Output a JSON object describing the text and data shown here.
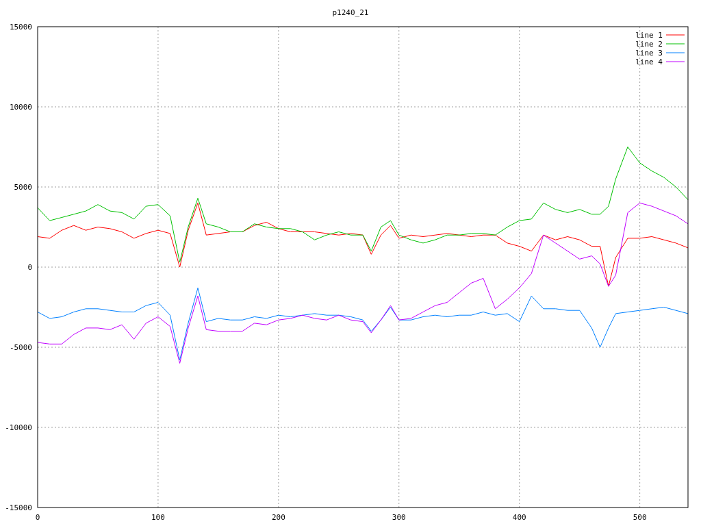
{
  "chart_data": {
    "type": "line",
    "title": "p1240_21",
    "x": [
      0,
      10,
      20,
      30,
      40,
      50,
      60,
      70,
      80,
      90,
      100,
      110,
      118,
      125,
      133,
      140,
      150,
      160,
      170,
      180,
      190,
      200,
      210,
      220,
      230,
      240,
      250,
      260,
      270,
      277,
      285,
      293,
      300,
      310,
      320,
      330,
      340,
      350,
      360,
      370,
      380,
      390,
      400,
      410,
      420,
      430,
      440,
      450,
      460,
      467,
      474,
      480,
      490,
      500,
      510,
      520,
      530,
      540
    ],
    "series": [
      {
        "name": "line 1",
        "color": "#ff0000",
        "values": [
          1900,
          1800,
          2300,
          2600,
          2300,
          2500,
          2400,
          2200,
          1800,
          2100,
          2300,
          2100,
          0,
          2300,
          4000,
          2000,
          2100,
          2200,
          2200,
          2600,
          2800,
          2400,
          2200,
          2200,
          2200,
          2100,
          2000,
          2100,
          2000,
          800,
          2000,
          2600,
          1800,
          2000,
          1900,
          2000,
          2100,
          2000,
          1900,
          2000,
          2000,
          1500,
          1300,
          1000,
          2000,
          1700,
          1900,
          1700,
          1300,
          1300,
          -1200,
          600,
          1800,
          1800,
          1900,
          1700,
          1500,
          1200
        ]
      },
      {
        "name": "line 2",
        "color": "#00c000",
        "values": [
          3700,
          2900,
          3100,
          3300,
          3500,
          3900,
          3500,
          3400,
          3000,
          3800,
          3900,
          3200,
          300,
          2500,
          4300,
          2700,
          2500,
          2200,
          2200,
          2700,
          2500,
          2400,
          2400,
          2200,
          1700,
          2000,
          2200,
          2000,
          2000,
          1000,
          2500,
          2900,
          2000,
          1700,
          1500,
          1700,
          2000,
          2000,
          2100,
          2100,
          2000,
          2500,
          2900,
          3000,
          4000,
          3600,
          3400,
          3600,
          3300,
          3300,
          3800,
          5500,
          7500,
          6500,
          6000,
          5600,
          5000,
          4200
        ]
      },
      {
        "name": "line 3",
        "color": "#0080ff",
        "values": [
          -2800,
          -3200,
          -3100,
          -2800,
          -2600,
          -2600,
          -2700,
          -2800,
          -2800,
          -2400,
          -2200,
          -3000,
          -5800,
          -3500,
          -1300,
          -3400,
          -3200,
          -3300,
          -3300,
          -3100,
          -3200,
          -3000,
          -3100,
          -3000,
          -2900,
          -3000,
          -3000,
          -3100,
          -3300,
          -4000,
          -3300,
          -2500,
          -3300,
          -3300,
          -3100,
          -3000,
          -3100,
          -3000,
          -3000,
          -2800,
          -3000,
          -2900,
          -3400,
          -1800,
          -2600,
          -2600,
          -2700,
          -2700,
          -3800,
          -5000,
          -3800,
          -2900,
          -2800,
          -2700,
          -2600,
          -2500,
          -2700,
          -2900
        ]
      },
      {
        "name": "line 4",
        "color": "#c000ff",
        "values": [
          -4700,
          -4800,
          -4800,
          -4200,
          -3800,
          -3800,
          -3900,
          -3600,
          -4500,
          -3500,
          -3100,
          -3700,
          -6000,
          -3800,
          -1800,
          -3900,
          -4000,
          -4000,
          -4000,
          -3500,
          -3600,
          -3300,
          -3200,
          -3000,
          -3200,
          -3300,
          -3000,
          -3300,
          -3400,
          -4100,
          -3300,
          -2400,
          -3300,
          -3200,
          -2800,
          -2400,
          -2200,
          -1600,
          -1000,
          -700,
          -2600,
          -2000,
          -1300,
          -400,
          2000,
          1500,
          1000,
          500,
          700,
          200,
          -1200,
          -500,
          3400,
          4000,
          3800,
          3500,
          3200,
          2700
        ]
      }
    ],
    "grid": true,
    "legend": true,
    "xlim": [
      0,
      540
    ],
    "ylim": [
      -15000,
      15000
    ],
    "xticks": [
      0,
      100,
      200,
      300,
      400,
      500
    ],
    "yticks": [
      -15000,
      -10000,
      -5000,
      0,
      5000,
      10000,
      15000
    ]
  }
}
